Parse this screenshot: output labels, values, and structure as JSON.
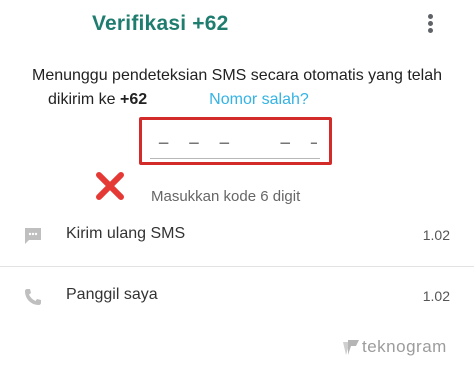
{
  "header": {
    "title": "Verifikasi +62"
  },
  "description": {
    "text_line1": "Menunggu pendeteksian SMS secara otomatis yang telah",
    "text_line2_prefix": "dikirim ke ",
    "phone": "+62",
    "wrong_number_link": "Nomor salah?"
  },
  "code_input": {
    "placeholder": "‒ ‒ ‒   ‒ ‒ ‒",
    "value": "",
    "hint": "Masukkan kode 6 digit"
  },
  "options": [
    {
      "label": "Kirim ulang SMS",
      "timer": "1.02",
      "icon": "message-icon"
    },
    {
      "label": "Panggil saya",
      "timer": "1.02",
      "icon": "phone-icon"
    }
  ],
  "watermark": {
    "text": "teknogram"
  },
  "colors": {
    "accent": "#1f7d6f",
    "link": "#34b3e4",
    "highlight_border": "#d32a2a",
    "error_cross": "#e53935"
  }
}
